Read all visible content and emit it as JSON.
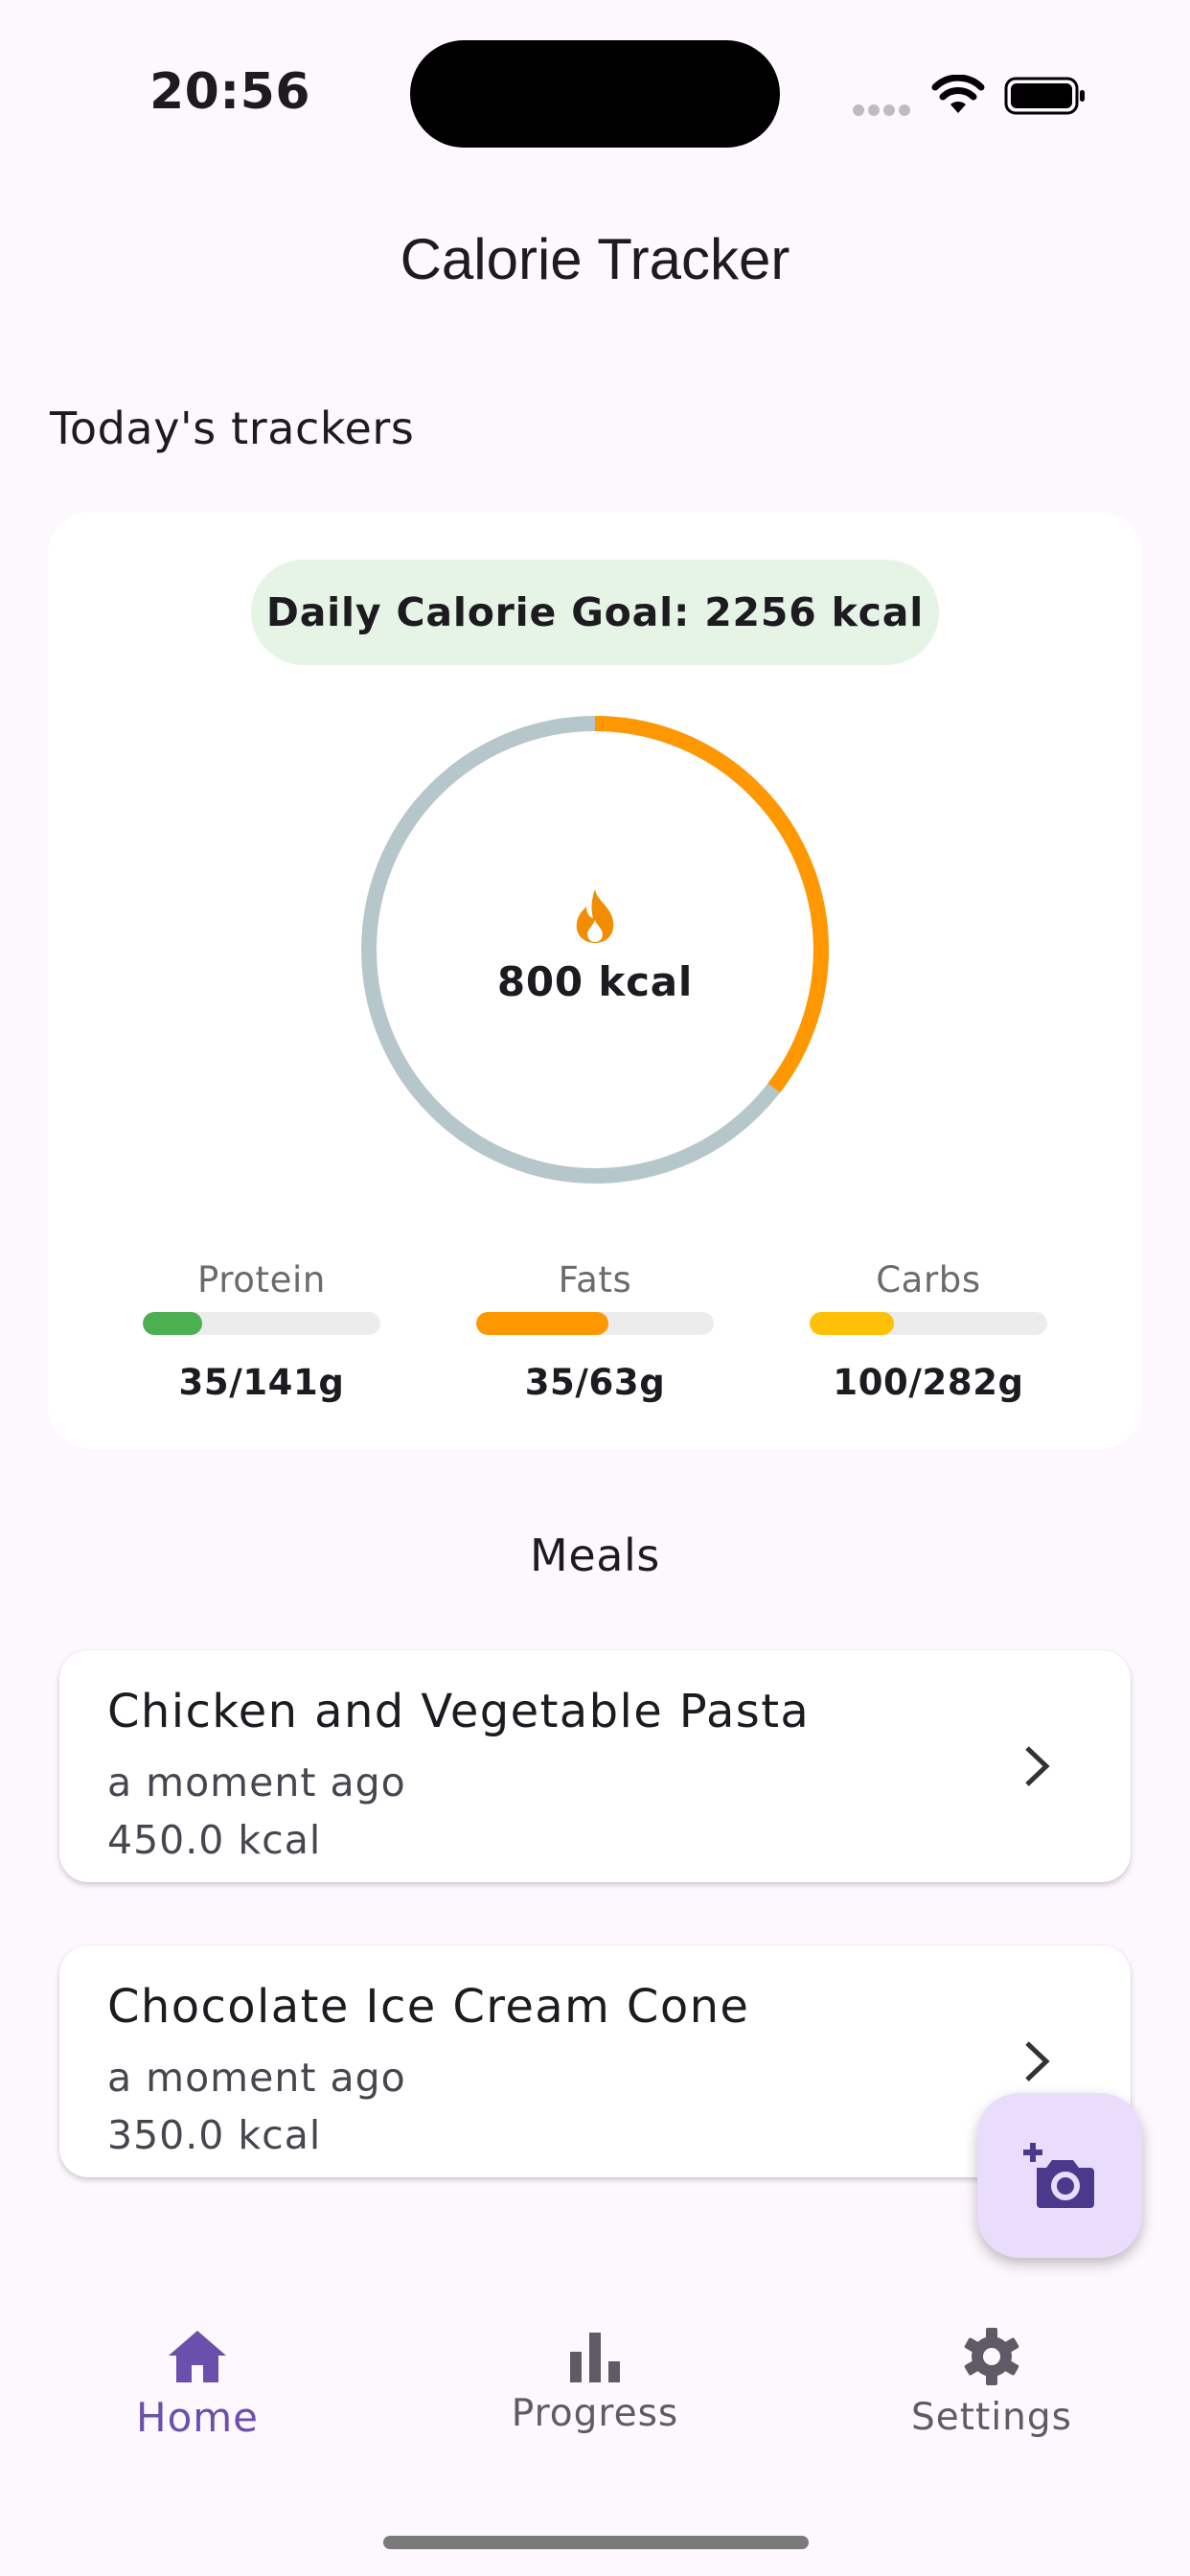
{
  "status_bar": {
    "time": "20:56"
  },
  "app": {
    "title": "Calorie Tracker"
  },
  "trackers": {
    "section_label": "Today's trackers",
    "goal_label": "Daily Calorie Goal: 2256 kcal",
    "consumed_label": "800 kcal",
    "consumed_fraction": 0.3546,
    "macros": [
      {
        "label": "Protein",
        "value": "35/141g",
        "fraction": 0.248,
        "color": "#4caf50"
      },
      {
        "label": "Fats",
        "value": "35/63g",
        "fraction": 0.556,
        "color": "#ff9800"
      },
      {
        "label": "Carbs",
        "value": "100/282g",
        "fraction": 0.355,
        "color": "#ffc107"
      }
    ],
    "colors": {
      "ring_progress": "#ff9800",
      "ring_track": "#b6c7cb",
      "goal_pill": "#e6f4e6"
    }
  },
  "meals": {
    "heading": "Meals",
    "items": [
      {
        "name": "Chicken and Vegetable Pasta",
        "time": "a moment ago",
        "kcal": "450.0 kcal"
      },
      {
        "name": "Chocolate Ice Cream Cone",
        "time": "a moment ago",
        "kcal": "350.0 kcal"
      }
    ]
  },
  "fab": {
    "icon": "add-photo-camera-icon"
  },
  "bottom_nav": {
    "items": [
      {
        "label": "Home",
        "icon": "home-icon",
        "active": true
      },
      {
        "label": "Progress",
        "icon": "bar-chart-icon",
        "active": false
      },
      {
        "label": "Settings",
        "icon": "gear-icon",
        "active": false
      }
    ],
    "accent": "#6a4fad"
  }
}
